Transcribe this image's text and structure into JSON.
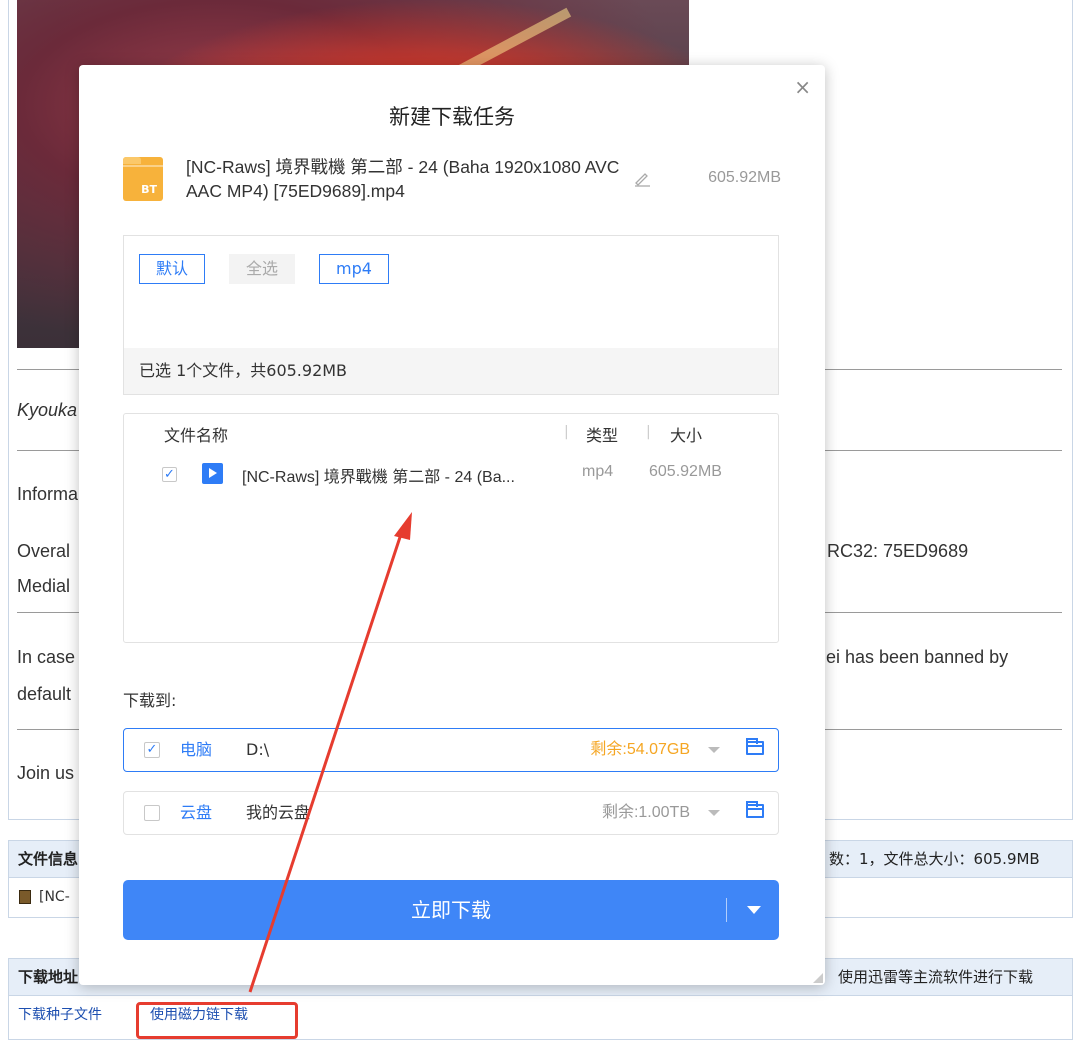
{
  "background": {
    "text_lines": [
      {
        "id": "kyouka",
        "text": "Kyouka"
      },
      {
        "id": "informa",
        "text": "Informa"
      },
      {
        "id": "overall",
        "text": "Overal"
      },
      {
        "id": "crc",
        "text": "RC32: 75ED9689"
      },
      {
        "id": "medial",
        "text": "Medial"
      },
      {
        "id": "in_case",
        "text": "In case"
      },
      {
        "id": "banned",
        "text": "ei has been banned by"
      },
      {
        "id": "default",
        "text": "default"
      },
      {
        "id": "join",
        "text": "Join us"
      }
    ],
    "file_info_label": "文件信息",
    "file_info_summary": "数：1，文件总大小：605.9MB",
    "file_row_text": "[NC-",
    "download_addr_label": "下载地址",
    "download_addr_hint": "使用迅雷等主流软件进行下载",
    "torrent_link": "下载种子文件",
    "magnet_link": "使用磁力链下载"
  },
  "modal": {
    "title": "新建下载任务",
    "close_icon": "×",
    "bt_badge": "BT",
    "file_title": "[NC-Raws] 境界戰機 第二部 - 24 (Baha 1920x1080 AVC AAC MP4) [75ED9689].mp4",
    "file_size": "605.92MB",
    "filters": [
      "默认",
      "全选",
      "mp4"
    ],
    "selected_summary": "已选 1个文件，共605.92MB",
    "columns": {
      "name": "文件名称",
      "type": "类型",
      "size": "大小"
    },
    "files": [
      {
        "name": "[NC-Raws] 境界戰機 第二部 - 24 (Ba...",
        "type": "mp4",
        "size": "605.92MB",
        "checked": true
      }
    ],
    "download_to_label": "下载到:",
    "destinations": [
      {
        "name": "电脑",
        "path": "D:\\",
        "free": "剩余:54.07GB",
        "free_color": "#f5a623",
        "checked": true
      },
      {
        "name": "云盘",
        "path": "我的云盘",
        "free": "剩余:1.00TB",
        "free_color": "#999999",
        "checked": false
      }
    ],
    "download_button": "立即下载"
  },
  "colors": {
    "accent": "#3f86f7",
    "annotation": "#e63c2f"
  }
}
